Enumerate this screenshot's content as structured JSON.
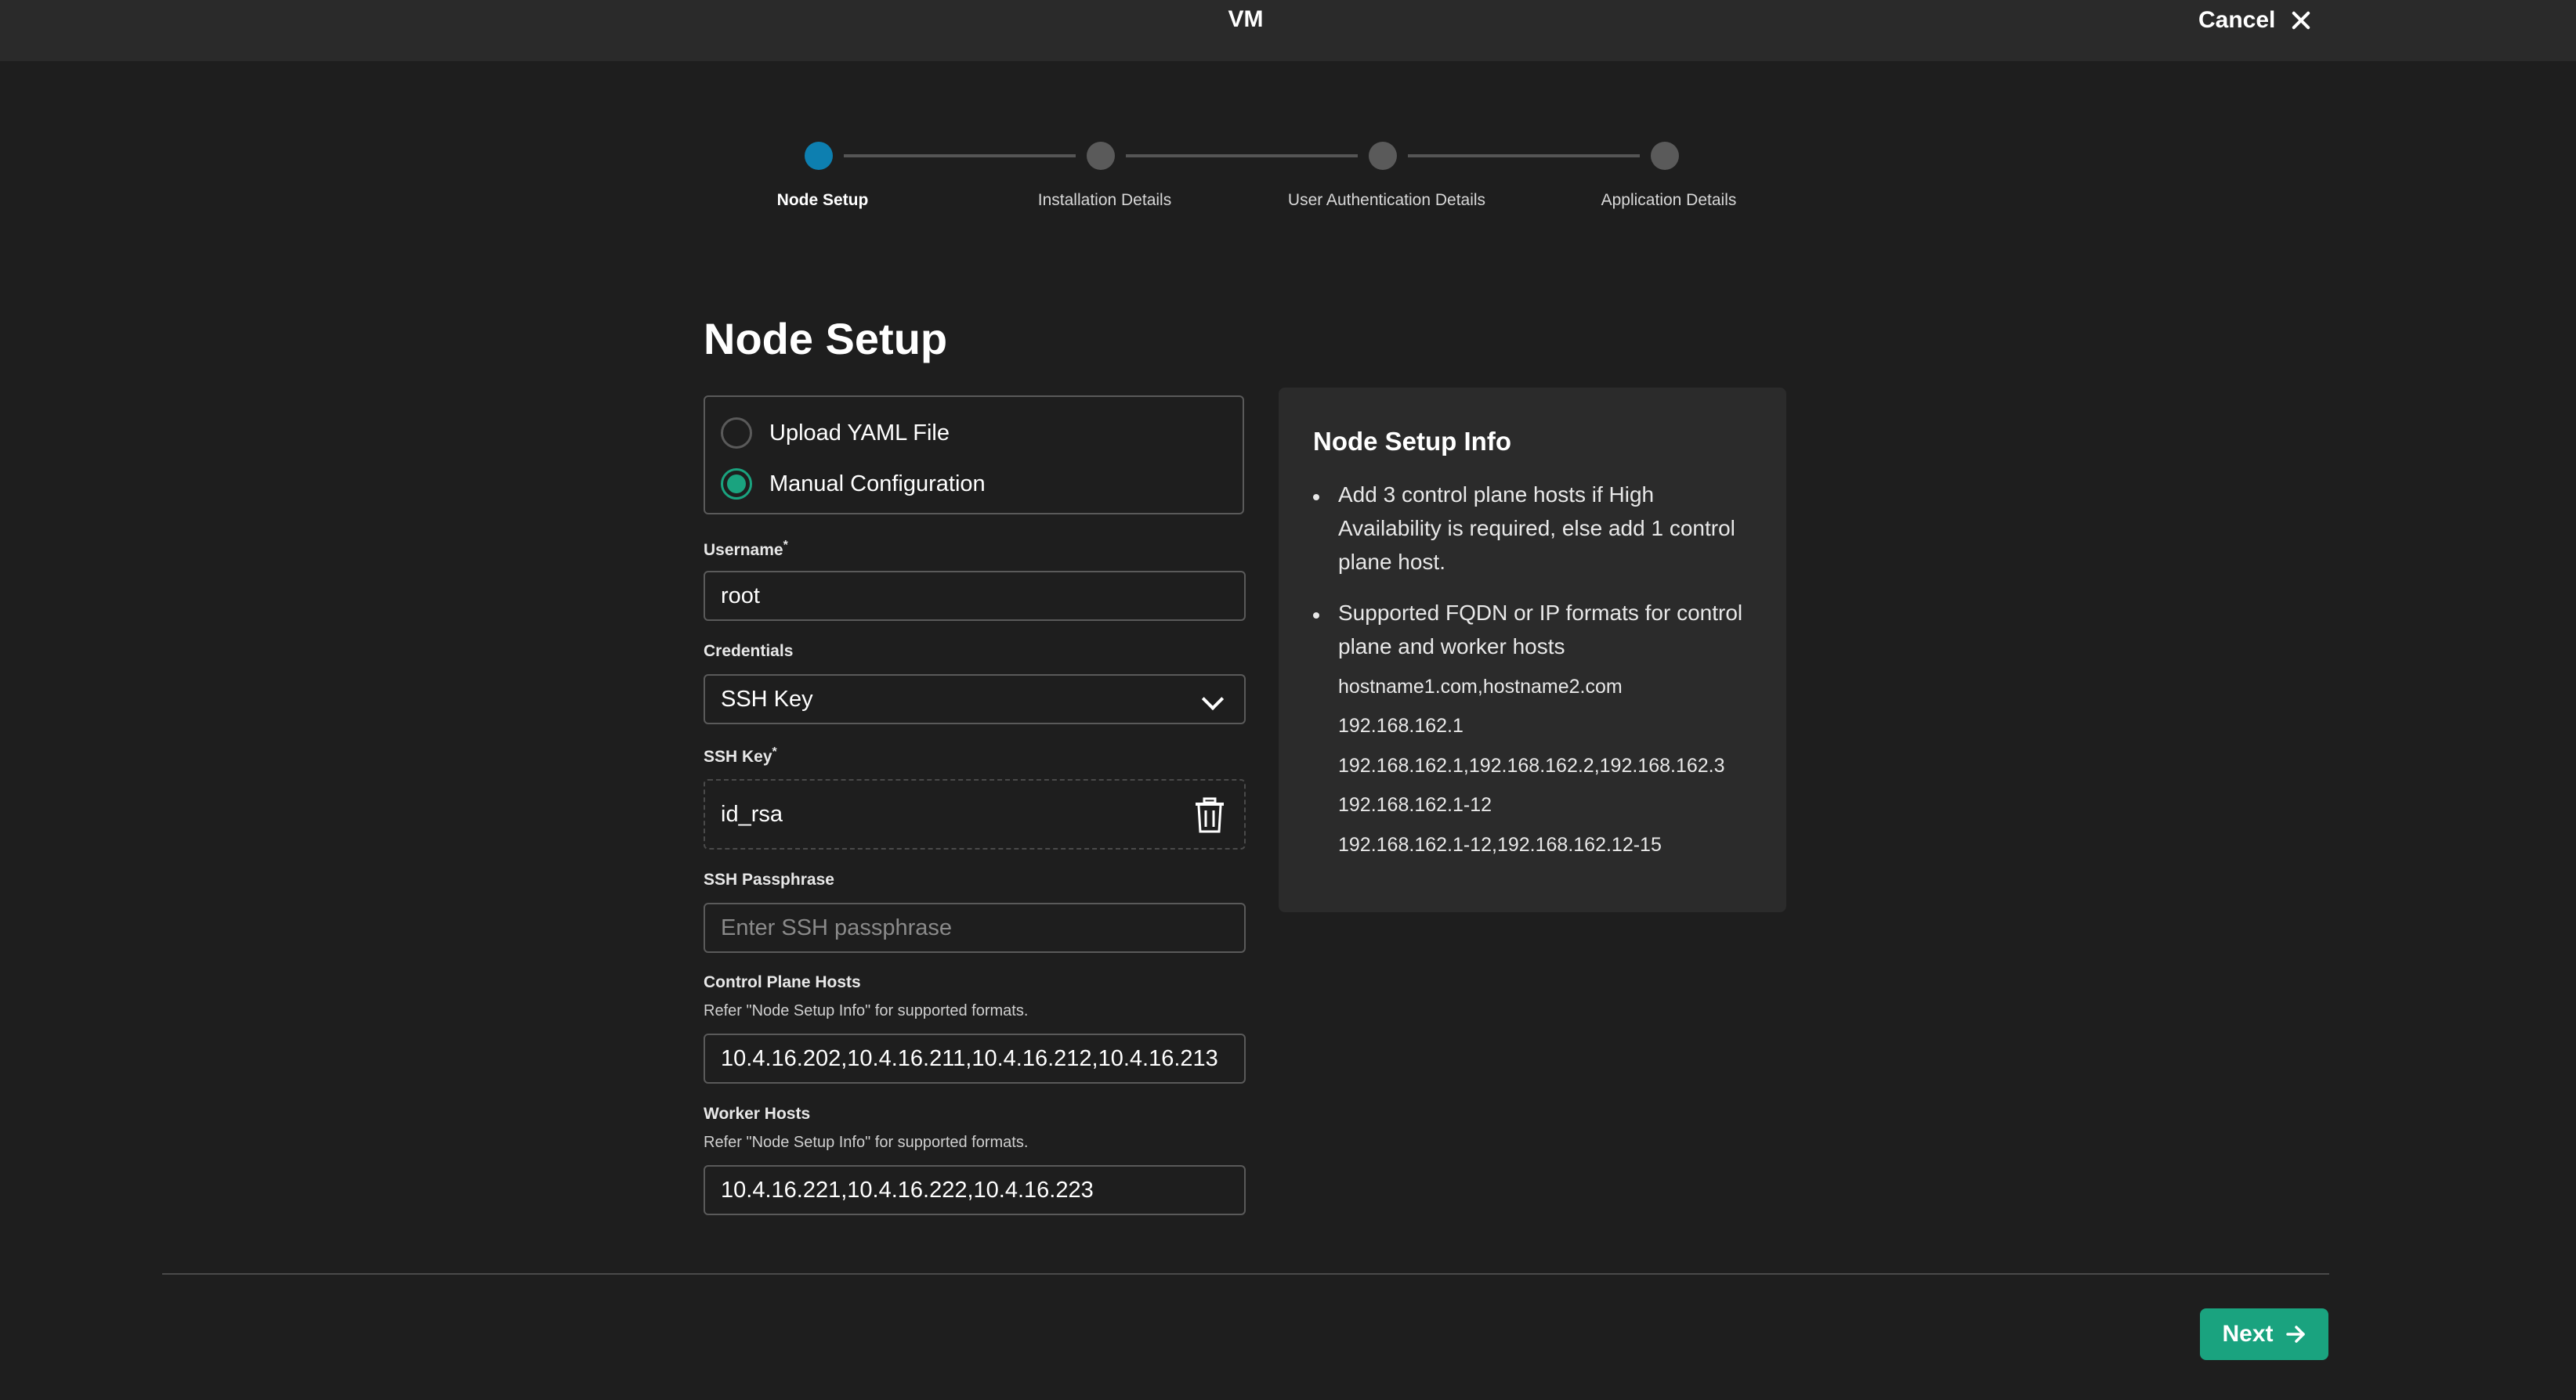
{
  "header": {
    "title": "VM",
    "cancel_label": "Cancel"
  },
  "stepper": {
    "steps": [
      {
        "label": "Node Setup",
        "active": true
      },
      {
        "label": "Installation Details",
        "active": false
      },
      {
        "label": "User Authentication Details",
        "active": false
      },
      {
        "label": "Application Details",
        "active": false
      }
    ]
  },
  "page_title": "Node Setup",
  "mode": {
    "options": [
      {
        "label": "Upload YAML File",
        "checked": false
      },
      {
        "label": "Manual Configuration",
        "checked": true
      }
    ]
  },
  "form": {
    "username": {
      "label": "Username",
      "required_mark": "*",
      "value": "root"
    },
    "credentials": {
      "label": "Credentials",
      "value": "SSH Key"
    },
    "ssh_key": {
      "label": "SSH Key",
      "required_mark": "*",
      "value": "id_rsa"
    },
    "ssh_passphrase": {
      "label": "SSH Passphrase",
      "placeholder": "Enter SSH passphrase"
    },
    "control_plane_hosts": {
      "label": "Control Plane Hosts",
      "help": "Refer \"Node Setup Info\" for supported formats.",
      "value": "10.4.16.202,10.4.16.211,10.4.16.212,10.4.16.213"
    },
    "worker_hosts": {
      "label": "Worker Hosts",
      "help": "Refer \"Node Setup Info\" for supported formats.",
      "value": "10.4.16.221,10.4.16.222,10.4.16.223"
    }
  },
  "info": {
    "title": "Node Setup Info",
    "bullets": [
      "Add 3 control plane hosts if High Availability is required, else add 1 control plane host.",
      "Supported FQDN or IP formats for control plane and worker hosts"
    ],
    "formats": [
      "hostname1.com,hostname2.com",
      "192.168.162.1",
      "192.168.162.1,192.168.162.2,192.168.162.3",
      "192.168.162.1-12",
      "192.168.162.1-12,192.168.162.12-15"
    ]
  },
  "footer": {
    "next_label": "Next"
  },
  "colors": {
    "accent_teal": "#1aa37f",
    "active_step": "#0d7fb0",
    "background": "#1e1e1e",
    "panel": "#2b2b2b"
  }
}
